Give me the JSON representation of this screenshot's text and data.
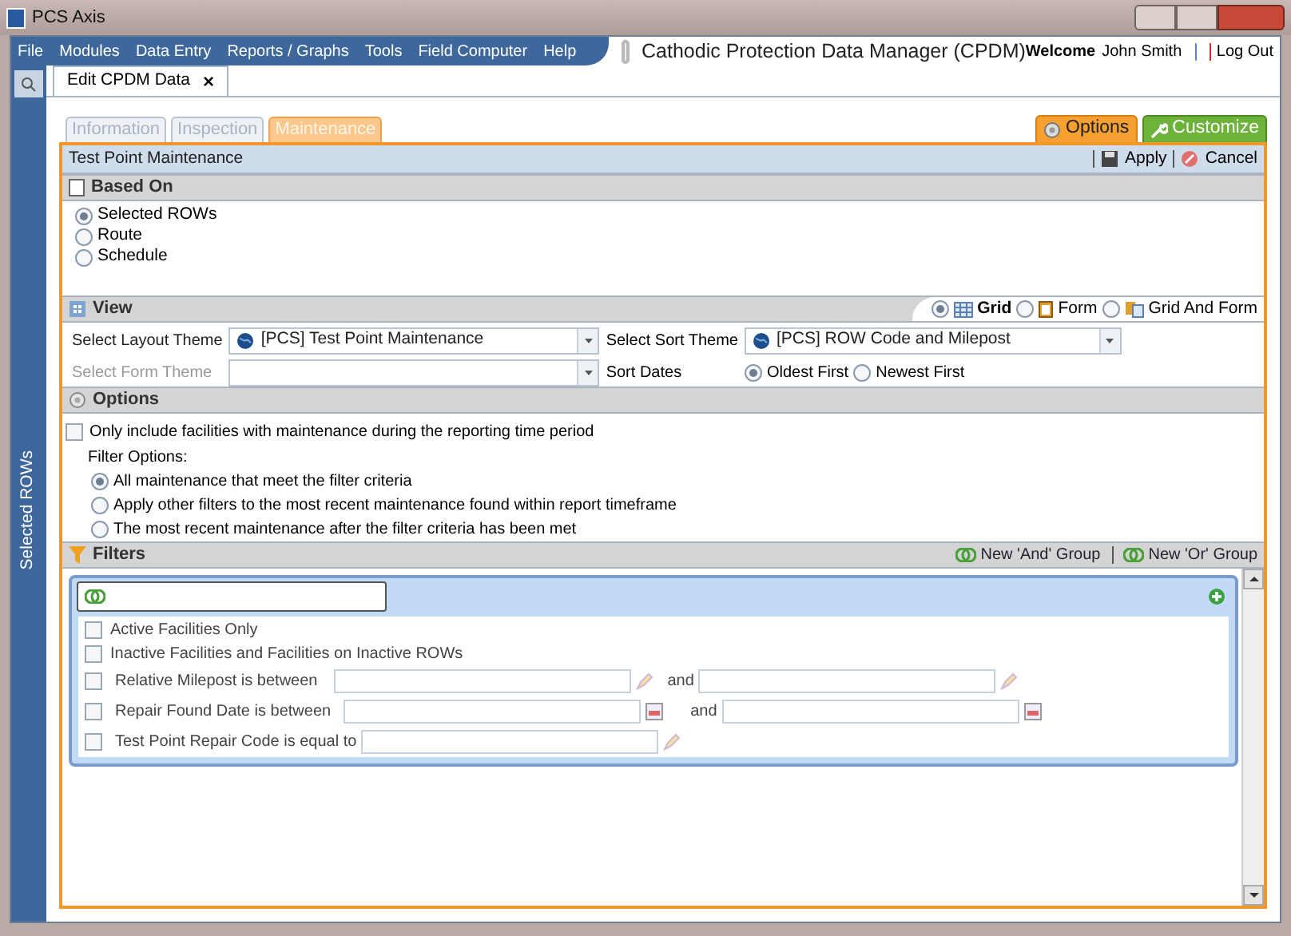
{
  "window": {
    "title": "PCS Axis"
  },
  "menu": [
    "File",
    "Modules",
    "Data Entry",
    "Reports / Graphs",
    "Tools",
    "Field Computer",
    "Help"
  ],
  "app_title": "Cathodic Protection Data Manager (CPDM)",
  "user": {
    "welcome": "Welcome",
    "name": "John Smith",
    "logout": "Log Out"
  },
  "sidebar": {
    "label": "Selected ROWs"
  },
  "doc_tab": {
    "label": "Edit CPDM Data",
    "close": "×"
  },
  "subtabs": [
    {
      "label": "Information",
      "selected": false
    },
    {
      "label": "Inspection",
      "selected": false
    },
    {
      "label": "Maintenance",
      "selected": true
    }
  ],
  "top_buttons": [
    {
      "label": "Options",
      "kind": "options"
    },
    {
      "label": "Customize",
      "kind": "customize"
    }
  ],
  "panel": {
    "title": "Test Point Maintenance",
    "actions": [
      {
        "label": "Apply",
        "kind": "save"
      },
      {
        "label": "Cancel",
        "kind": "cancel"
      }
    ]
  },
  "based_on": {
    "title": "Based On",
    "options": [
      {
        "label": "Selected ROWs",
        "selected": true
      },
      {
        "label": "Route",
        "selected": false
      },
      {
        "label": "Schedule",
        "selected": false
      }
    ]
  },
  "view": {
    "title": "View",
    "modes": [
      {
        "label": "Grid",
        "selected": true,
        "kind": "grid"
      },
      {
        "label": "Form",
        "selected": false,
        "kind": "form"
      },
      {
        "label": "Grid And Form",
        "selected": false,
        "kind": "gridform"
      }
    ],
    "layout_theme": {
      "label": "Select Layout Theme",
      "value": "[PCS] Test Point Maintenance"
    },
    "form_theme": {
      "label": "Select Form Theme",
      "disabled": true
    },
    "sort_theme": {
      "label": "Select Sort Theme",
      "value": "[PCS] ROW Code and Milepost"
    },
    "sort_dates": {
      "label": "Sort Dates",
      "options": [
        {
          "label": "Oldest First",
          "selected": true
        },
        {
          "label": "Newest First",
          "selected": false
        }
      ]
    }
  },
  "options": {
    "title": "Options",
    "checkbox": {
      "label": "Only include facilities with maintenance during the reporting time period",
      "checked": false
    },
    "filter_label": "Filter Options:",
    "radios": [
      {
        "label": "All maintenance that meet the filter criteria",
        "selected": true
      },
      {
        "label": "Apply other filters to the most recent maintenance found within report timeframe",
        "selected": false
      },
      {
        "label": "The most recent maintenance after the filter criteria has been met",
        "selected": false
      }
    ]
  },
  "filters": {
    "title": "Filters",
    "actions": [
      "New 'And' Group",
      "New 'Or' Group"
    ],
    "rows": [
      {
        "kind": "check",
        "label": "Active Facilities Only",
        "checked": false
      },
      {
        "kind": "check",
        "label": "Inactive Facilities and Facilities on Inactive ROWs",
        "checked": false
      },
      {
        "kind": "range",
        "label": "Relative Milepost is between",
        "checked": false,
        "and": "and"
      },
      {
        "kind": "date_range",
        "label": "Repair Found Date is between",
        "checked": false,
        "and": "and"
      },
      {
        "kind": "single",
        "label": "Test Point Repair Code is equal to",
        "checked": false
      }
    ]
  }
}
